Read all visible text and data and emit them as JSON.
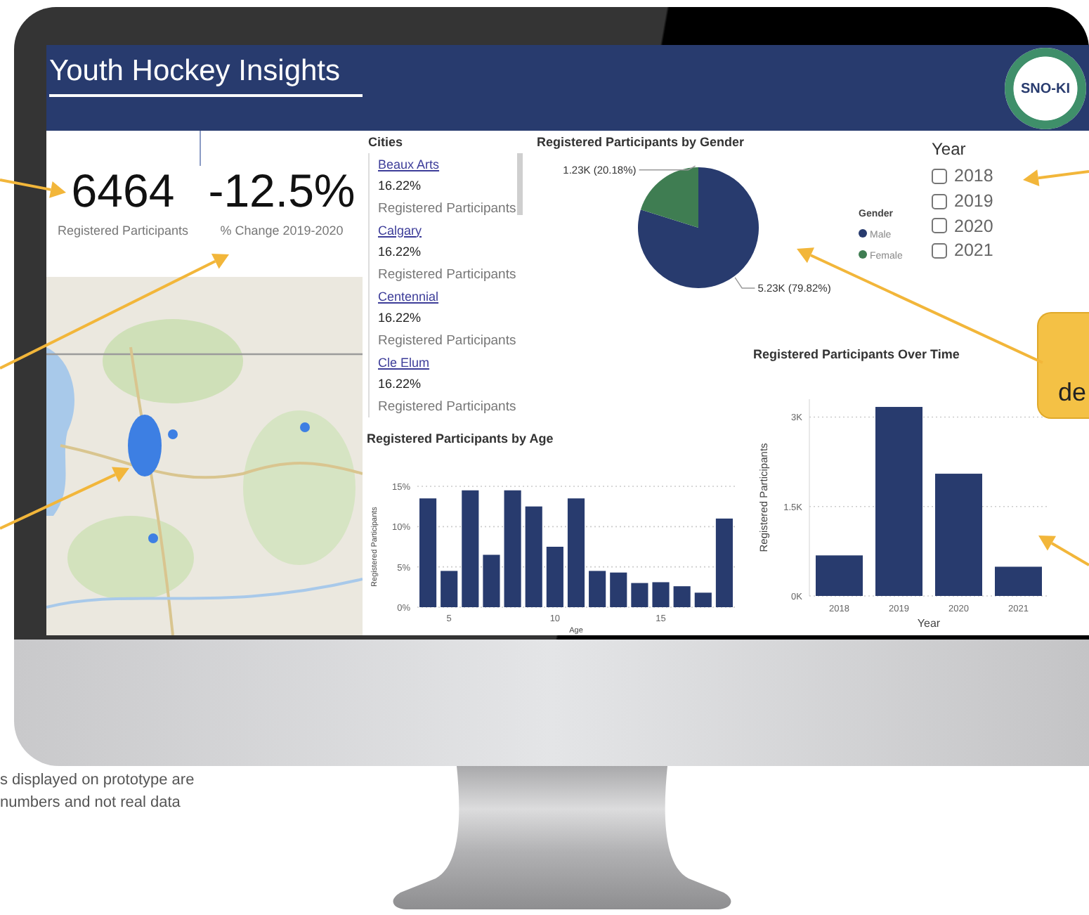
{
  "dashboard": {
    "title": "Youth Hockey Insights",
    "logo_text": "SNO-KI",
    "kpis": [
      {
        "value": "6464",
        "label": "Registered Participants"
      },
      {
        "value": "-12.5%",
        "label": "% Change 2019-2020"
      }
    ],
    "cities": {
      "heading": "Cities",
      "items": [
        {
          "name": "Beaux Arts",
          "value": "16.22%",
          "label": "Registered Participants"
        },
        {
          "name": "Calgary",
          "value": "16.22%",
          "label": "Registered Participants"
        },
        {
          "name": "Centennial",
          "value": "16.22%",
          "label": "Registered Participants"
        },
        {
          "name": "Cle Elum",
          "value": "16.22%",
          "label": "Registered Participants"
        }
      ]
    },
    "gender_chart": {
      "title": "Registered Participants by Gender",
      "legend_title": "Gender",
      "slices": [
        {
          "color": "#283b6e"
        },
        {
          "color": "#3f7d52"
        }
      ],
      "chart_data": {
        "type": "pie",
        "categories": [
          "Male",
          "Female"
        ],
        "series": [
          {
            "values": [
              79.82,
              20.18
            ]
          }
        ],
        "legend": "right",
        "value_labels": [
          "5.23K (79.82%)",
          "1.23K (20.18%)"
        ]
      }
    },
    "year_slicer": {
      "title": "Year",
      "options": [
        {
          "label": "2018",
          "checked": false
        },
        {
          "label": "2019",
          "checked": false
        },
        {
          "label": "2020",
          "checked": false
        },
        {
          "label": "2021",
          "checked": false
        }
      ]
    },
    "age_chart": {
      "title": "Registered Participants by Age",
      "chart_data": {
        "type": "bar",
        "xlabel": "Age",
        "ylabel": "Registered Participants",
        "x": [
          4,
          5,
          6,
          7,
          8,
          9,
          10,
          11,
          12,
          13,
          14,
          15,
          16,
          17,
          18
        ],
        "series": [
          {
            "color": "#283b6e",
            "values": [
              13.5,
              4.5,
              14.5,
              6.5,
              14.5,
              12.5,
              7.5,
              13.5,
              4.5,
              4.3,
              3,
              3.1,
              2.6,
              1.8,
              11
            ]
          }
        ],
        "xlim": [
          3.5,
          18.5
        ],
        "ylim": [
          0,
          15
        ],
        "yticks": [
          {
            "value": 0,
            "label": "0%"
          },
          {
            "value": 5,
            "label": "5%"
          },
          {
            "value": 10,
            "label": "10%"
          },
          {
            "value": 15,
            "label": "15%"
          }
        ],
        "xticks": [
          5,
          10,
          15
        ],
        "grid": true
      }
    },
    "time_chart": {
      "title": "Registered Participants Over Time",
      "chart_data": {
        "type": "bar",
        "xlabel": "Year",
        "ylabel": "Registered Participants",
        "categories": [
          "2018",
          "2019",
          "2020",
          "2021"
        ],
        "series": [
          {
            "color": "#283b6e",
            "values": [
              680,
              3170,
              2050,
              490
            ]
          }
        ],
        "ylim": [
          0,
          3300
        ],
        "yticks": [
          {
            "value": 0,
            "label": "0K"
          },
          {
            "value": 1500,
            "label": "1.5K"
          },
          {
            "value": 3000,
            "label": "3K"
          }
        ],
        "grid": true
      }
    }
  },
  "caption": [
    "s displayed on prototype are",
    "numbers and not real data"
  ],
  "callout": {
    "text": "de"
  }
}
